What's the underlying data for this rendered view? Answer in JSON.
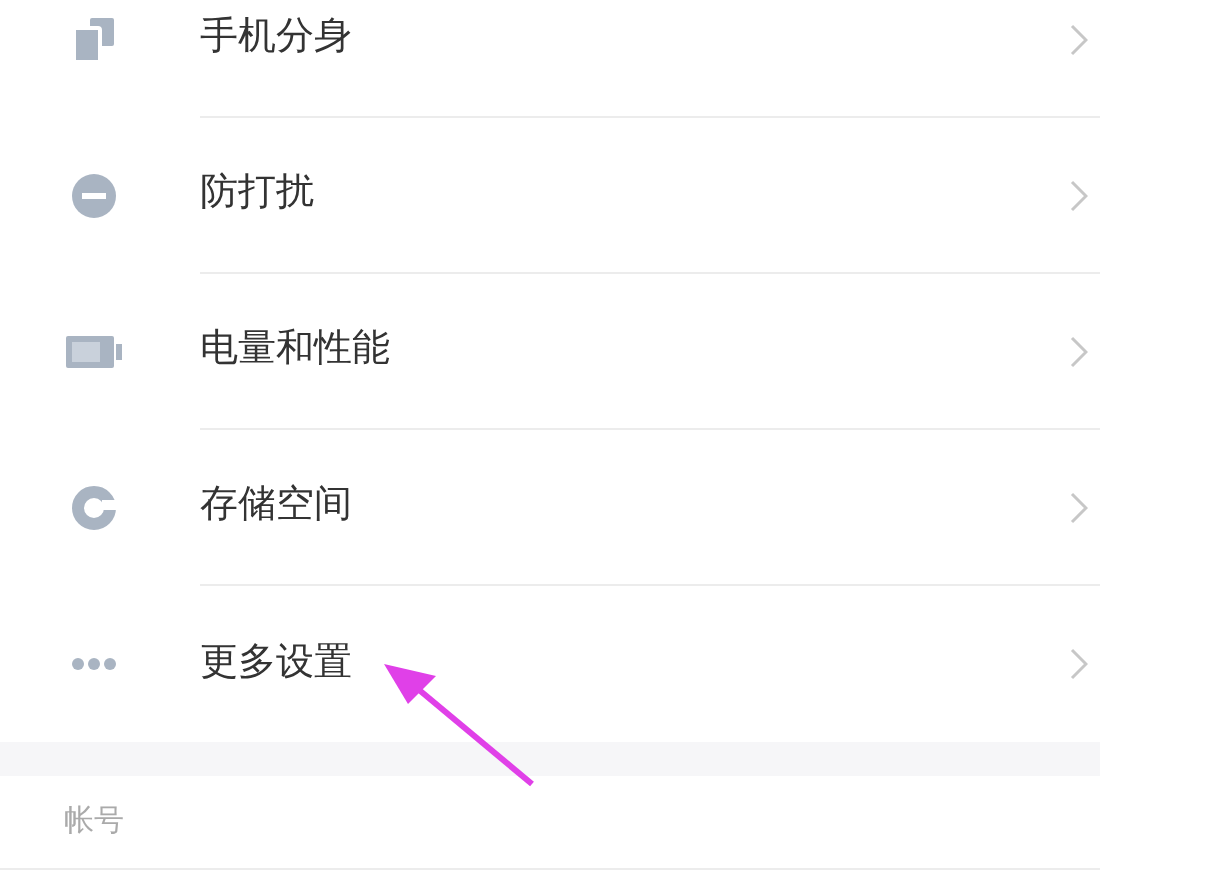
{
  "settings_items": [
    {
      "label": "手机分身",
      "kind": "clone"
    },
    {
      "label": "防打扰",
      "kind": "dnd"
    },
    {
      "label": "电量和性能",
      "kind": "battery"
    },
    {
      "label": "存储空间",
      "kind": "storage"
    },
    {
      "label": "更多设置",
      "kind": "more"
    }
  ],
  "section_header": "帐号"
}
